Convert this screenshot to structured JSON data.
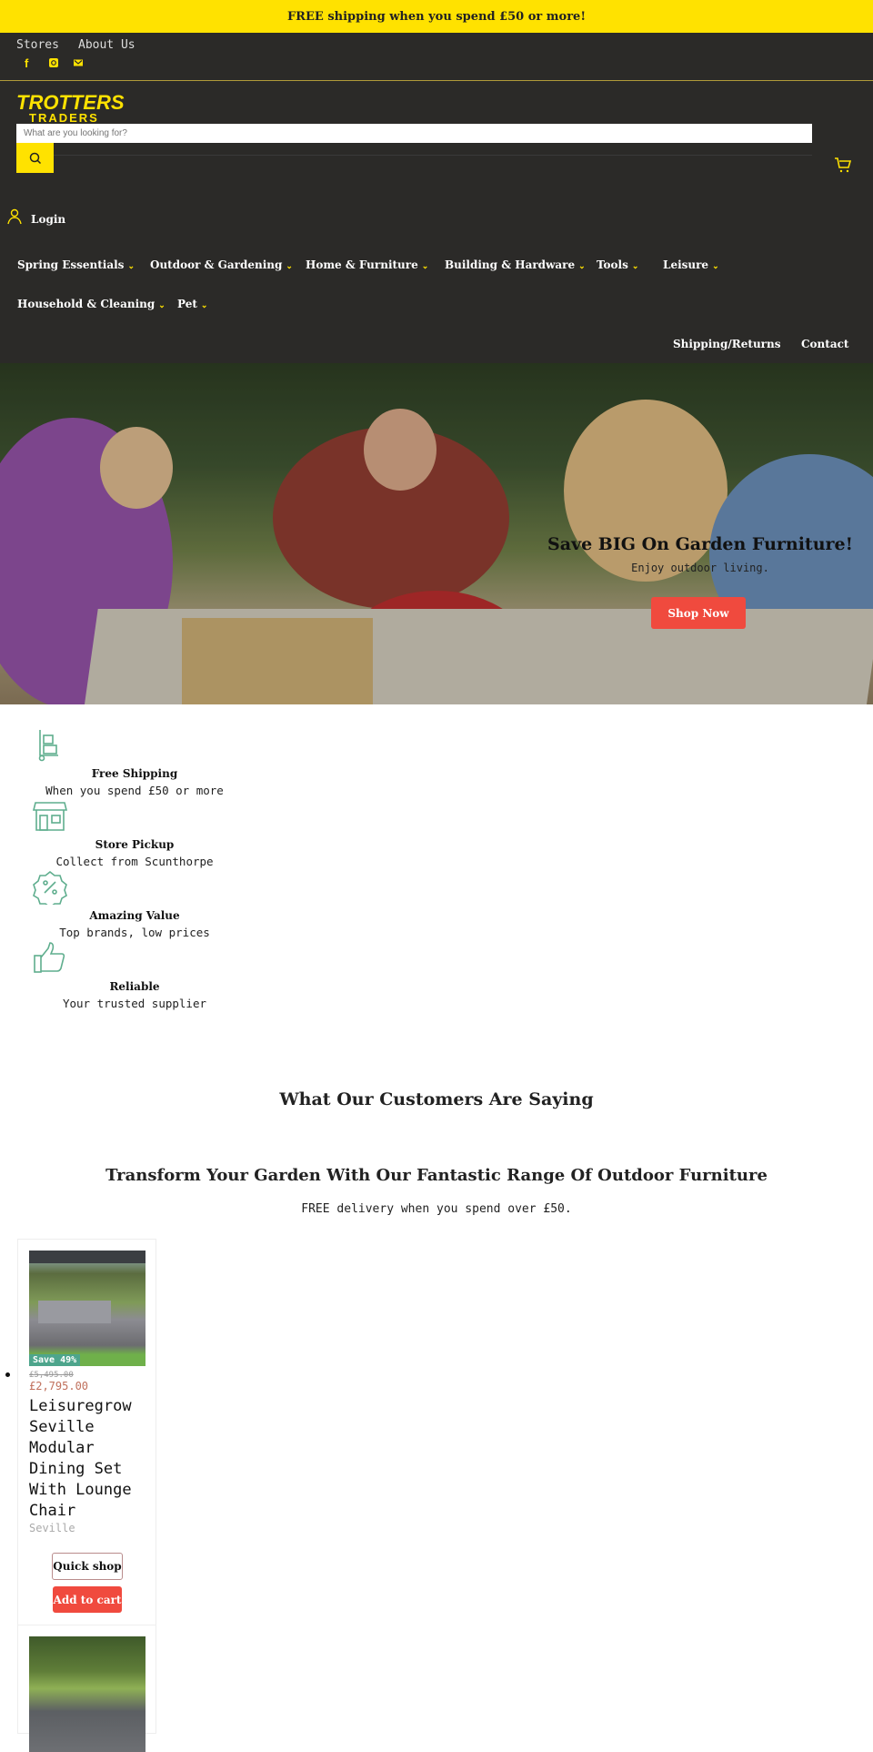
{
  "announcement": "FREE shipping when you spend £50 or more!",
  "top_links": [
    "Stores",
    "About Us"
  ],
  "social": [
    "facebook-icon",
    "instagram-icon",
    "email-icon"
  ],
  "logo": {
    "line1": "TROTTERS",
    "line2": "TRADERS"
  },
  "search": {
    "placeholder": "What are you looking for?"
  },
  "login": "Login",
  "nav": [
    "Spring Essentials",
    "Outdoor & Gardening",
    "Home & Furniture",
    "Building & Hardware",
    "Tools",
    "Leisure",
    "Household & Cleaning",
    "Pet"
  ],
  "nav_right": [
    "Shipping/Returns",
    "Contact"
  ],
  "hero": {
    "title": "Save BIG On Garden Furniture!",
    "subtitle": "Enjoy outdoor living.",
    "button": "Shop Now"
  },
  "features": [
    {
      "icon": "delivery-trolley-icon",
      "title": "Free Shipping",
      "subtitle": "When you spend £50 or more"
    },
    {
      "icon": "store-icon",
      "title": "Store Pickup",
      "subtitle": "Collect from Scunthorpe"
    },
    {
      "icon": "percent-badge-icon",
      "title": "Amazing Value",
      "subtitle": "Top brands, low prices"
    },
    {
      "icon": "thumbs-up-icon",
      "title": "Reliable",
      "subtitle": "Your trusted supplier"
    }
  ],
  "testimonials_heading": "What Our Customers Are Saying",
  "collection": {
    "heading": "Transform Your Garden With Our Fantastic Range Of Outdoor Furniture",
    "subheading": "FREE delivery when you spend over £50."
  },
  "products": [
    {
      "badge": "Save 49%",
      "compare_price": "£5,495.00",
      "price": "£2,795.00",
      "title": "Leisuregrow Seville Modular Dining Set With Lounge Chair",
      "vendor": "Seville",
      "quick_shop": "Quick shop",
      "add_to_cart": "Add to cart"
    }
  ],
  "colors": {
    "accent": "#ffe200",
    "header_bg": "#2b2a28",
    "button_red": "#f04a3e",
    "icon_green": "#5fae8e",
    "sale_price": "#c0705c"
  }
}
